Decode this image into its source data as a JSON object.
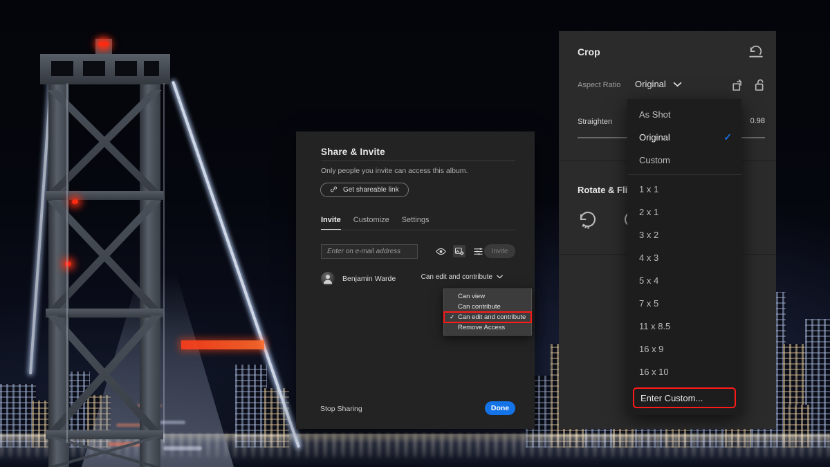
{
  "share_dialog": {
    "title": "Share & Invite",
    "subtitle": "Only people you invite can access this album.",
    "shareable_link_label": "Get shareable link",
    "link_icon": "link-icon",
    "tabs": [
      {
        "label": "Invite",
        "active": true
      },
      {
        "label": "Customize",
        "active": false
      },
      {
        "label": "Settings",
        "active": false
      }
    ],
    "email_placeholder": "Enter on e-mail address",
    "email_value": "",
    "row_icons": [
      "eye-icon",
      "add-photo-icon",
      "sliders-icon"
    ],
    "invite_button_label": "Invite",
    "person": {
      "name": "Benjamin Warde",
      "avatar": "user-avatar",
      "permission": "Can edit and contribute"
    },
    "permission_menu": {
      "items": [
        {
          "label": "Can view",
          "checked": false,
          "highlighted": false
        },
        {
          "label": "Can contribute",
          "checked": false,
          "highlighted": false
        },
        {
          "label": "Can edit and contribute",
          "checked": true,
          "highlighted": true
        },
        {
          "label": "Remove Access",
          "checked": false,
          "highlighted": false
        }
      ]
    },
    "stop_sharing_label": "Stop Sharing",
    "done_label": "Done",
    "done_color": "#1473e6",
    "highlight_color": "#ff1a1a"
  },
  "crop_panel": {
    "title": "Crop",
    "reset_icon": "reset-undo-icon",
    "aspect_ratio_label": "Aspect Ratio",
    "aspect_ratio_value": "Original",
    "chevron_icon": "chevron-down-icon",
    "rotate_icon": "rotate-square-icon",
    "lock_icon": "unlocked-padlock-icon",
    "straighten_label": "Straighten",
    "straighten_value": "0.98",
    "rotate_flip_title": "Rotate & Flip",
    "rotate_buttons": [
      "rotate-counterclockwise-icon",
      "rotate-clockwise-icon"
    ]
  },
  "aspect_ratio_menu": {
    "group_one": [
      {
        "label": "As Shot",
        "selected": false
      },
      {
        "label": "Original",
        "selected": true
      },
      {
        "label": "Custom",
        "selected": false
      }
    ],
    "group_two": [
      {
        "label": "1 x 1"
      },
      {
        "label": "2 x 1"
      },
      {
        "label": "3 x 2"
      },
      {
        "label": "4 x 3"
      },
      {
        "label": "5 x 4"
      },
      {
        "label": "7 x 5"
      },
      {
        "label": "11 x 8.5"
      },
      {
        "label": "16 x 9"
      },
      {
        "label": "16 x 10"
      }
    ],
    "enter_custom_label": "Enter Custom...",
    "check_color": "#1473e6",
    "highlight_color": "#ff1a1a"
  },
  "background": {
    "description": "Night photograph of the Bay Bridge tower with San Francisco city skyline"
  }
}
